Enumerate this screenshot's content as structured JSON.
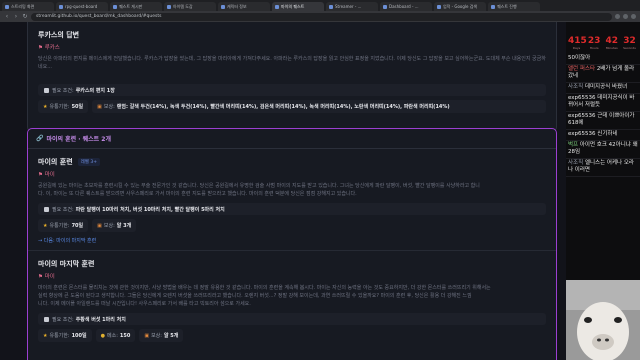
{
  "browser": {
    "tabs": [
      {
        "label": "스트리밍 화면"
      },
      {
        "label": "rpg-quest-board"
      },
      {
        "label": "퀘스트 게시판"
      },
      {
        "label": "아이템 도감"
      },
      {
        "label": "캐릭터 정보"
      },
      {
        "label": "마이의 퀘스트"
      },
      {
        "label": "Streamer - ..."
      },
      {
        "label": "Dashboard - ..."
      },
      {
        "label": "업적 - Google 검색"
      },
      {
        "label": "퀘스트 진행"
      }
    ],
    "url": "streamlit.github.io/quest_board/mk_dashboard/#quests"
  },
  "card_lucas": {
    "title": "루카스의 답변",
    "giver": "루카스",
    "desc": "당신은 아파라의 편지를 메이스에게 전달했습니다. 루카스가 답장을 썼는데, 그 답장을 마리아에게 가져다주세요. 아파라는 루카스의 답장을 읽고 안심한 표정을 지었습니다. 이제 당신도 그 답장을 보고 싶어하는군요. 도대체 무슨 내용인지 궁금하네요...",
    "req_label": "필요 조건:",
    "req_value": "루카스의 편지 1장",
    "reward_time_label": "유통기한:",
    "reward_time_value": "50일",
    "reward_item_label": "보상:",
    "reward_item_value": "랜덤: 갈색 두건(14%), 녹색 두건(14%), 빨간색 머리띠(14%), 검은색 머리띠(14%), 녹색 머리띠(14%), 노란색 머리띠(14%), 파란색 머리띠(14%)"
  },
  "chain": {
    "title": "마이의 훈련 · 퀘스트 2개",
    "step1": {
      "title": "마이의 훈련",
      "badge": "레벨 3+",
      "giver": "마이",
      "desc1": "공원길에 있는 마이는 초보자를 훈련시킬 수 있는 무술 전문가인 것 같습니다. 당신은 공원길에서 유명한 검술 사범 마이의 지도를 받고 있습니다. 그녀는 당신에게 파란 달팽이, 버섯, 빨간 달팽이를 사냥하라고 합니",
      "desc2": "다. 이, 마이는 또 다른 퀘스트를 받으려면 사우스페리로 가서 마이의 훈련 지도를 받으라고 했습니다. 마이의 훈련 덕분에 당신은 점점 강해지고 있습니다.",
      "req_label": "필요 조건:",
      "req_value": "파란 달팽이 10마리 처치, 버섯 10마리 처치, 빨간 달팽이 5마리 처치",
      "time_label": "유통기한:",
      "time_value": "70일",
      "item_label": "보상:",
      "item_value": "알 3개",
      "next": "→ 다음: 마이의 마지막 훈련"
    },
    "step2": {
      "title": "마이의 마지막 훈련",
      "giver": "마이",
      "desc1": "마이의 훈련은 몬스터를 물리치는 것에 관한 것이지만, 사냥 방법을 배우는 데 정말 유용한 것 같습니다. 마이의 훈련을 계속해 봅시다. 마이는 자신의 능력을 아는 것도 중요하지만, 더 강한 몬스터를 쓰러뜨리기 위해서는",
      "desc2": "실력 향상에 큰 도움이 된다고 생각합니다. 그들은 당신에게 오렌지 버섯을 쓰러뜨리라고 했습니다. 오렌지 버섯...? 정말 강해 보이는데, 과연 쓰러뜨릴 수 있을까요? 마이의 훈련 후, 당신은 활용 더 강해진 느낌",
      "desc3": "니다. 이제 메이플 아일랜드를 떠날 시간입니다! 사우스페리로 가서 배를 타고 빅토리아 섬으로 가세요.",
      "req_label": "필요 조건:",
      "req_value": "주황색 버섯 1마리 처치",
      "time_label": "유통기한:",
      "time_value": "100일",
      "exp_label": "메소:",
      "exp_value": "150",
      "item_label": "보상:",
      "item_value": "알 5개"
    }
  },
  "chat": {
    "timer": [
      {
        "num": "415",
        "label": "Days"
      },
      {
        "num": "23",
        "label": "Hours"
      },
      {
        "num": "42",
        "label": "Minutes"
      },
      {
        "num": "32",
        "label": "Seconds"
      }
    ],
    "messages": [
      {
        "user": "",
        "text": "50이잖아",
        "color": "#e8e8e8"
      },
      {
        "user": "앨런 퍼스타",
        "text": "2배가 넘게 올라갔네",
        "color": "#e06060"
      },
      {
        "user": "사조직",
        "text": "데미지공식 바꿨녀",
        "color": "#9aa0ae"
      },
      {
        "user": "exp65536",
        "text": "데미지공식이 바뀌어서 저럴듯",
        "color": "#e8e8e8"
      },
      {
        "user": "exp65536",
        "text": "근데 이쁘아이가 618에",
        "color": "#e8e8e8"
      },
      {
        "user": "exp65536",
        "text": "신기하네",
        "color": "#e8e8e8"
      },
      {
        "user": "벅프",
        "text": "아이먼 호크 42아니냐 왜 28임",
        "color": "#7fd07f"
      },
      {
        "user": "사조직",
        "text": "엘니스는 어케나 오라나 이러면",
        "color": "#9aa0ae"
      }
    ]
  }
}
